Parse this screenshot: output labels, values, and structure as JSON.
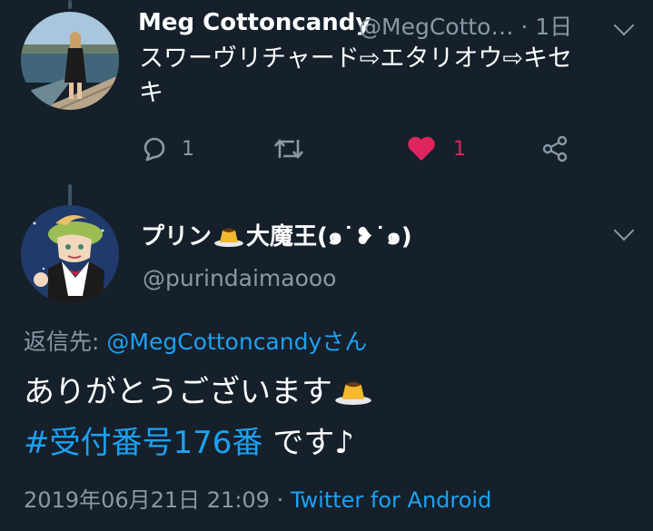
{
  "tweet1": {
    "display_name": "Meg Cottoncandy",
    "handle_and_time": "@MegCotto… · 1日",
    "text_line1": "スワーヴリチャード⇨エタリオウ⇨キセ",
    "text_line2": "キ",
    "actions": {
      "reply_count": "1",
      "retweet_count": "",
      "like_count": "1"
    }
  },
  "tweet2": {
    "display_name_prefix": "プリン",
    "display_name_suffix": "大魔王(๑˙❥˙๑)",
    "handle": "@purindaimaooo",
    "reply_to_label": "返信先: ",
    "reply_to_handle": "@MegCottoncandy",
    "reply_to_suffix": "さん",
    "body_line1": "ありがとうございます",
    "hashtag": "#受付番号176番",
    "body_line2_rest": " です♪",
    "timestamp": "2019年06月21日 21:09 · ",
    "source": "Twitter for Android"
  },
  "colors": {
    "background": "#15202b",
    "muted": "#8899a6",
    "accent": "#1da1f2",
    "like": "#e0245e"
  },
  "icons": [
    "reply-icon",
    "retweet-icon",
    "heart-icon",
    "share-icon",
    "chevron-down-icon",
    "pudding-emoji"
  ]
}
